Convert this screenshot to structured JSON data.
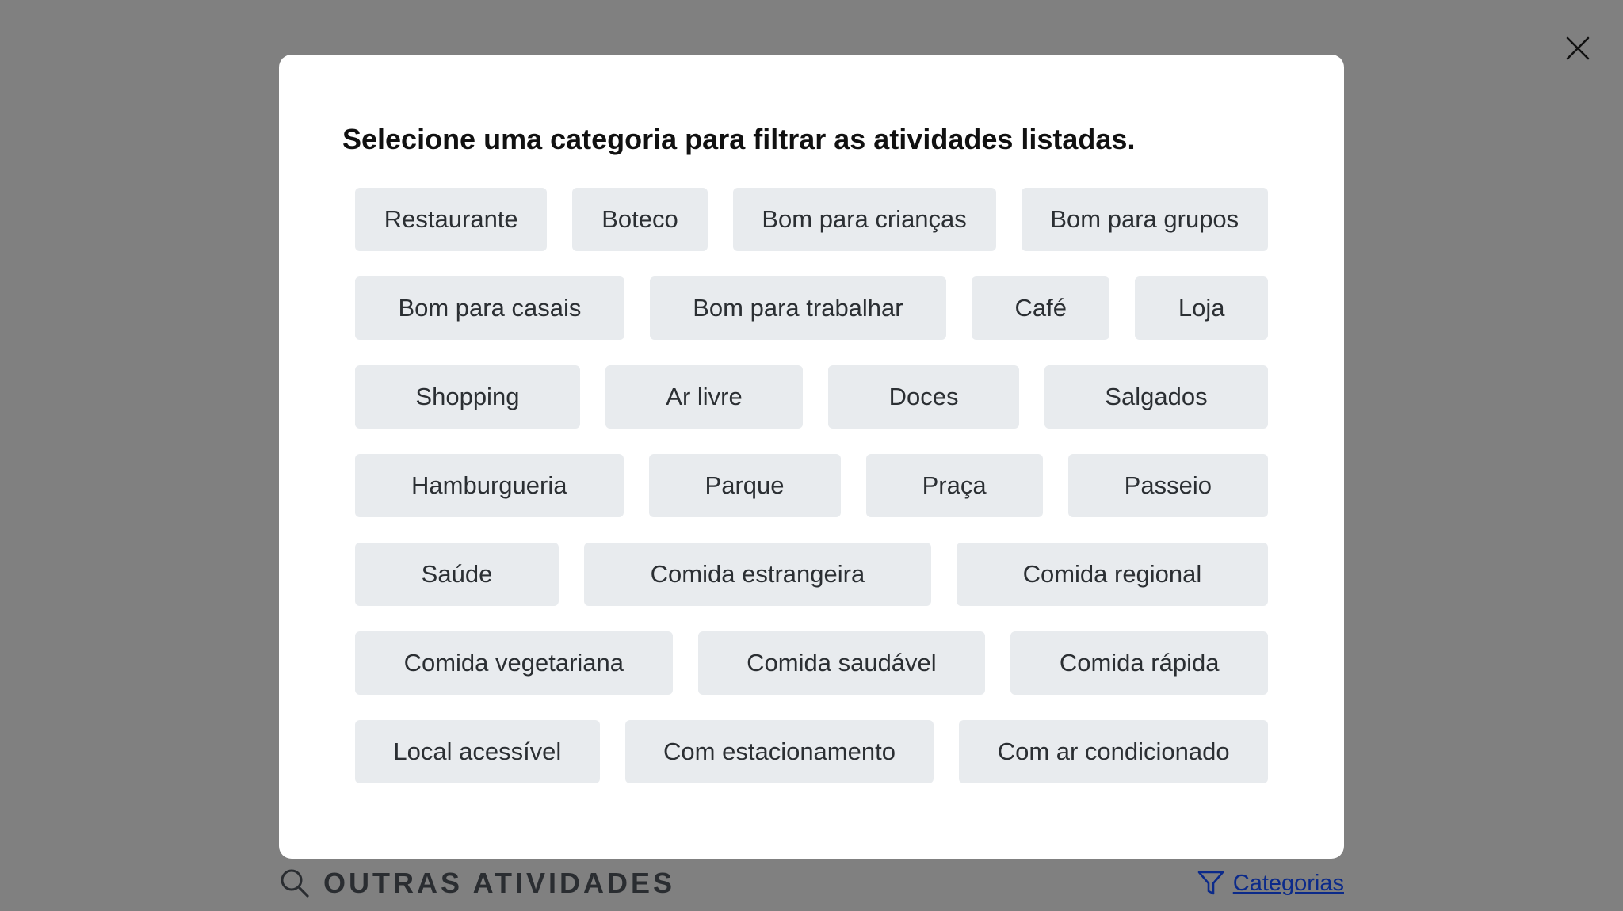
{
  "modal": {
    "title": "Selecione uma categoria para filtrar as atividades listadas.",
    "close_icon": "close-icon",
    "rows": [
      [
        "Restaurante",
        "Boteco",
        "Bom para crianças",
        "Bom para grupos"
      ],
      [
        "Bom para casais",
        "Bom para trabalhar",
        "Café",
        "Loja"
      ],
      [
        "Shopping",
        "Ar livre",
        "Doces",
        "Salgados"
      ],
      [
        "Hamburgueria",
        "Parque",
        "Praça",
        "Passeio"
      ],
      [
        "Saúde",
        "Comida estrangeira",
        "Comida regional"
      ],
      [
        "Comida vegetariana",
        "Comida saudável",
        "Comida rápida"
      ],
      [
        "Local acessível",
        "Com estacionamento",
        "Com ar condicionado"
      ]
    ]
  },
  "background": {
    "section_heading": "OUTRAS ATIVIDADES",
    "search_icon": "search-icon",
    "categories_link": "Categorias",
    "filter_icon": "filter-icon"
  },
  "colors": {
    "overlay": "#808080",
    "chip_bg": "#e8ebee",
    "chip_text": "#2b2f33",
    "link": "#0b2a8a"
  }
}
